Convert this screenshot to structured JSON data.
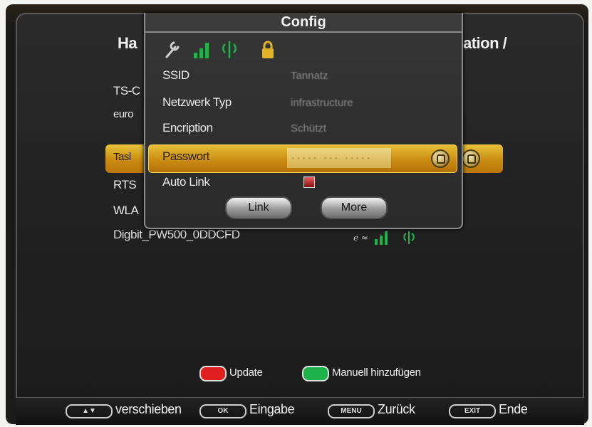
{
  "background": {
    "title_left": "Ha",
    "title_right": "ation /",
    "networks": [
      "TS-C",
      "euro",
      "Tasl",
      "RTS",
      "WLA",
      "Digbit_PW500_0DDCFD"
    ]
  },
  "popup": {
    "title": "Config",
    "fields": [
      {
        "label": "SSID",
        "value": "Tannatz"
      },
      {
        "label": "Netzwerk Typ",
        "value": "infrastructure"
      },
      {
        "label": "Encription",
        "value": "Schützt"
      },
      {
        "label": "Passwort",
        "value": "·····  ···  ·····"
      },
      {
        "label": "Auto Link",
        "value": ""
      }
    ],
    "buttons": {
      "link": "Link",
      "more": "More"
    }
  },
  "color_keys": [
    {
      "color": "#e02020",
      "label": "Update"
    },
    {
      "color": "#1fb24a",
      "label": "Manuell hinzufügen"
    }
  ],
  "nav": [
    {
      "key": "▲▼",
      "label": "verschieben"
    },
    {
      "key": "OK",
      "label": "Eingabe"
    },
    {
      "key": "MENU",
      "label": "Zurück"
    },
    {
      "key": "EXIT",
      "label": "Ende"
    }
  ],
  "colors": {
    "accent": "#d9a420",
    "signal": "#22b24a"
  }
}
